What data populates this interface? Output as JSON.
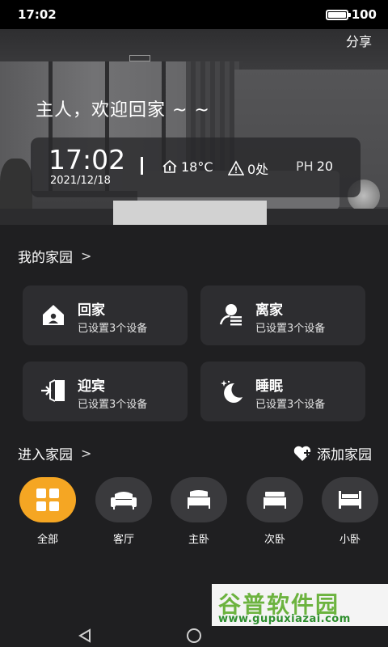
{
  "status": {
    "time": "17:02",
    "battery": "100"
  },
  "hero": {
    "share": "分享",
    "welcome": "主人，欢迎回家 ~ ~",
    "time": "17:02",
    "date": "2021/12/18",
    "temperature": "18°C",
    "alerts": "0处",
    "ph_label": "PH",
    "ph_value": "20"
  },
  "my_home": {
    "title": "我的家园",
    "chevron": ">"
  },
  "scenes": [
    {
      "name": "回家",
      "sub": "已设置3个设备",
      "icon": "home-icon"
    },
    {
      "name": "离家",
      "sub": "已设置3个设备",
      "icon": "leave-icon"
    },
    {
      "name": "迎宾",
      "sub": "已设置3个设备",
      "icon": "door-enter-icon"
    },
    {
      "name": "睡眠",
      "sub": "已设置3个设备",
      "icon": "moon-stars-icon"
    }
  ],
  "enter_home": {
    "title": "进入家园",
    "chevron": ">",
    "add": "添加家园"
  },
  "rooms": [
    {
      "label": "全部",
      "icon": "grid-icon",
      "active": true
    },
    {
      "label": "客厅",
      "icon": "sofa-icon"
    },
    {
      "label": "主卧",
      "icon": "bed-icon"
    },
    {
      "label": "次卧",
      "icon": "bed-icon"
    },
    {
      "label": "小卧",
      "icon": "bed-icon"
    }
  ],
  "watermark": {
    "title": "谷普软件园",
    "url": "www.gupuxiazai.com"
  },
  "colors": {
    "accent": "#f5a623",
    "background": "#1f1f21",
    "card": "#2d2d30"
  }
}
